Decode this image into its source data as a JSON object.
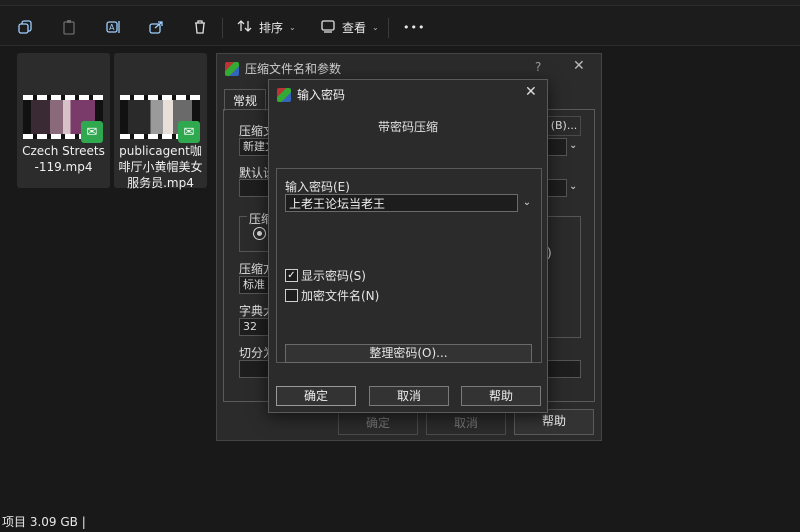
{
  "toolbar": {
    "sort_label": "排序",
    "view_label": "查看",
    "more_label": "•••"
  },
  "files": [
    {
      "name": "Czech Streets-119.mp4"
    },
    {
      "name": "publicagent咖啡厅小黄帽美女服务员.mp4"
    }
  ],
  "status": {
    "text": "项目 3.09 GB  |"
  },
  "back_dialog": {
    "title": "压缩文件名和参数",
    "help": "?",
    "tab_general": "常规",
    "label_archive": "压缩文",
    "archive_value": "新建文",
    "browse": "(B)...",
    "label_default": "默认设",
    "label_compress_group": "压缩",
    "label_method": "压缩方",
    "method_value": "标准",
    "label_dict": "字典大",
    "dict_value": "32",
    "label_split": "切分为",
    "paren": ")",
    "ok": "确定",
    "cancel": "取消",
    "help_btn": "帮助"
  },
  "dialog": {
    "title": "输入密码",
    "heading": "带密码压缩",
    "password_label": "输入密码(E)",
    "password_value": "上老王论坛当老王",
    "show_password_label": "显示密码(S)",
    "show_password_checked": true,
    "encrypt_names_label": "加密文件名(N)",
    "encrypt_names_checked": false,
    "organize_label": "整理密码(O)...",
    "ok_label": "确定",
    "cancel_label": "取消",
    "help_label": "帮助"
  }
}
